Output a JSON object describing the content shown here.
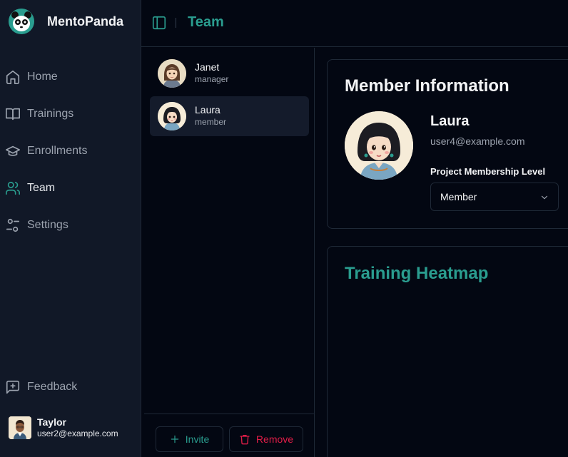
{
  "app": {
    "name": "MentoPanda"
  },
  "nav": [
    {
      "label": "Home",
      "icon": "home-icon"
    },
    {
      "label": "Trainings",
      "icon": "book-icon"
    },
    {
      "label": "Enrollments",
      "icon": "graduation-cap-icon"
    },
    {
      "label": "Team",
      "icon": "users-icon",
      "active": true
    },
    {
      "label": "Settings",
      "icon": "sliders-icon"
    }
  ],
  "feedback": {
    "label": "Feedback",
    "icon": "message-square-plus-icon"
  },
  "current_user": {
    "name": "Taylor",
    "email": "user2@example.com"
  },
  "header": {
    "title": "Team"
  },
  "members": [
    {
      "name": "Janet",
      "role": "manager"
    },
    {
      "name": "Laura",
      "role": "member",
      "selected": true
    }
  ],
  "actions": {
    "invite": "Invite",
    "remove": "Remove"
  },
  "member_info": {
    "title": "Member Information",
    "name": "Laura",
    "email": "user4@example.com",
    "level_label": "Project Membership Level",
    "level_value": "Member"
  },
  "heatmap": {
    "title": "Training Heatmap"
  },
  "colors": {
    "accent": "#2a9d8f",
    "danger": "#e11d48",
    "sidebar_bg": "#111827",
    "page_bg": "#030712"
  }
}
